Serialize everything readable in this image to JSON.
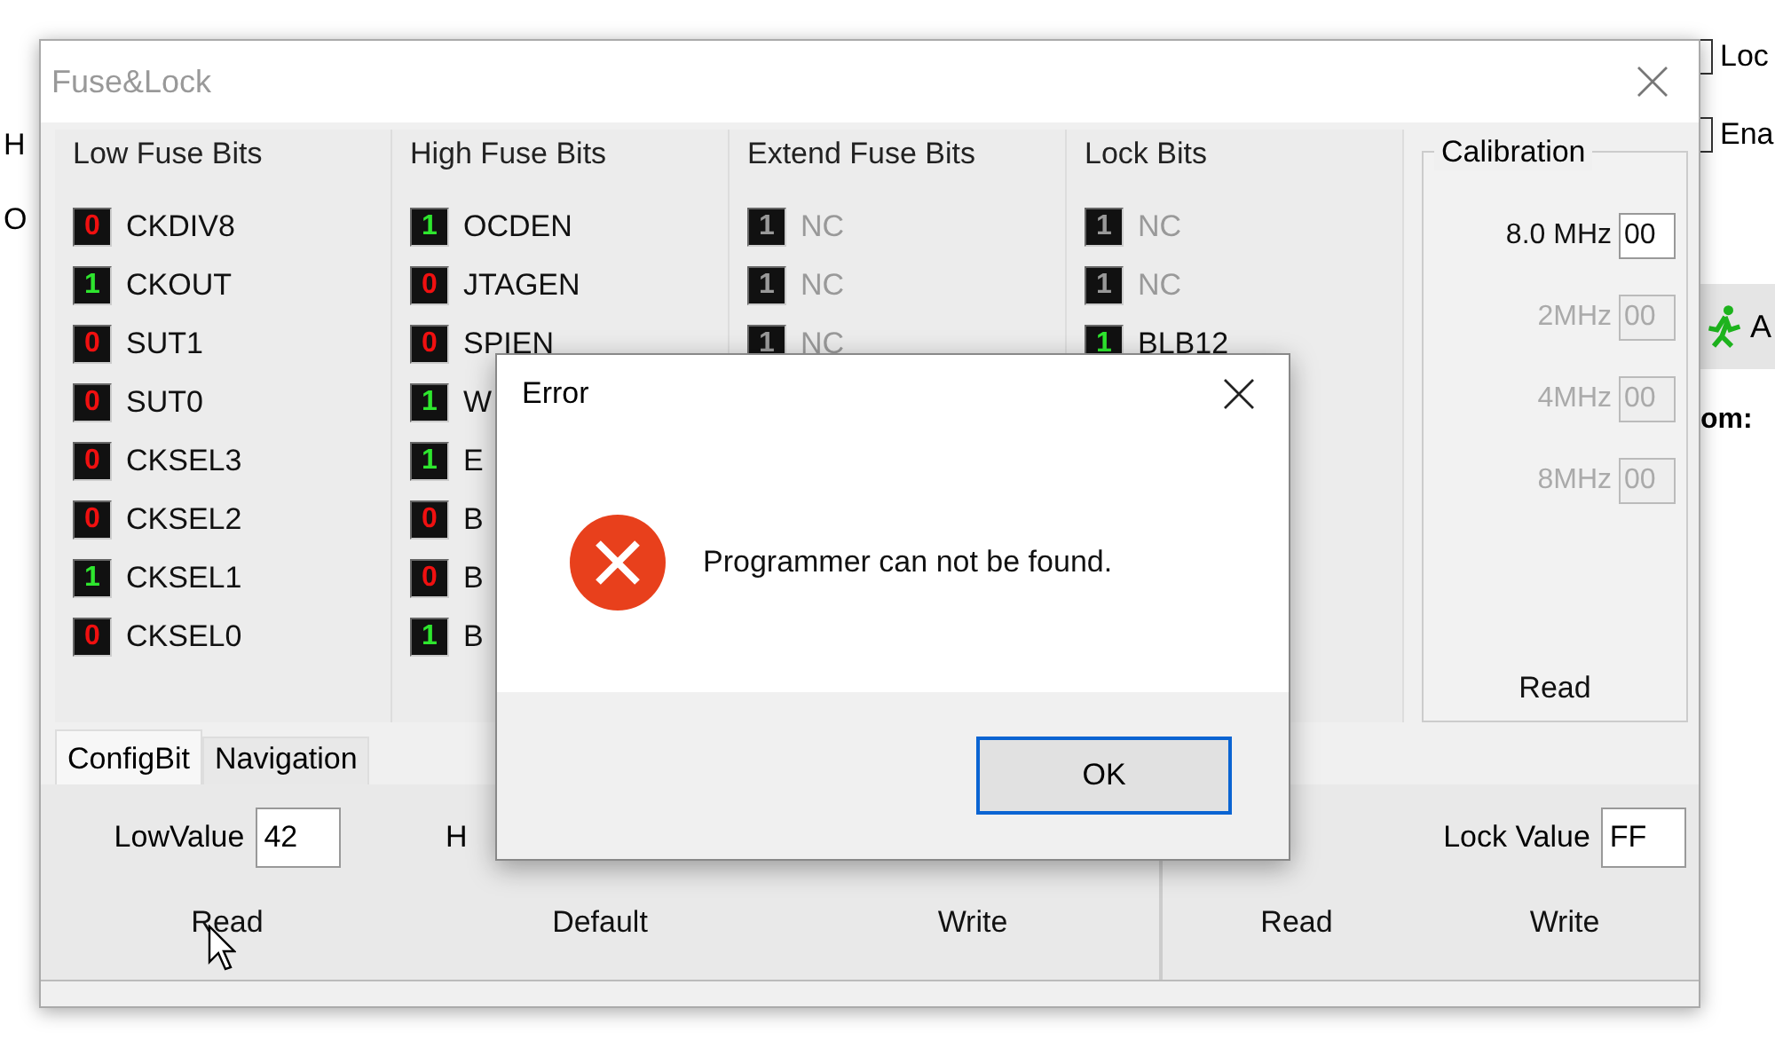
{
  "background_left": [
    "H",
    "O"
  ],
  "background_right": {
    "checkboxes": [
      {
        "label": "Loc",
        "checked": false
      },
      {
        "label": "Ena",
        "checked": false
      }
    ],
    "button": "A",
    "status": "om:"
  },
  "window": {
    "title": "Fuse&Lock"
  },
  "groups": [
    {
      "title": "Low Fuse Bits",
      "bits": [
        {
          "value": "0",
          "set": false,
          "disabled": false,
          "label": "CKDIV8"
        },
        {
          "value": "1",
          "set": true,
          "disabled": false,
          "label": "CKOUT"
        },
        {
          "value": "0",
          "set": false,
          "disabled": false,
          "label": "SUT1"
        },
        {
          "value": "0",
          "set": false,
          "disabled": false,
          "label": "SUT0"
        },
        {
          "value": "0",
          "set": false,
          "disabled": false,
          "label": "CKSEL3"
        },
        {
          "value": "0",
          "set": false,
          "disabled": false,
          "label": "CKSEL2"
        },
        {
          "value": "1",
          "set": true,
          "disabled": false,
          "label": "CKSEL1"
        },
        {
          "value": "0",
          "set": false,
          "disabled": false,
          "label": "CKSEL0"
        }
      ]
    },
    {
      "title": "High Fuse Bits",
      "bits": [
        {
          "value": "1",
          "set": true,
          "disabled": false,
          "label": "OCDEN"
        },
        {
          "value": "0",
          "set": false,
          "disabled": false,
          "label": "JTAGEN"
        },
        {
          "value": "0",
          "set": false,
          "disabled": false,
          "label": "SPIEN"
        },
        {
          "value": "1",
          "set": true,
          "disabled": false,
          "label": "W"
        },
        {
          "value": "1",
          "set": true,
          "disabled": false,
          "label": "E"
        },
        {
          "value": "0",
          "set": false,
          "disabled": false,
          "label": "B"
        },
        {
          "value": "0",
          "set": false,
          "disabled": false,
          "label": "B"
        },
        {
          "value": "1",
          "set": true,
          "disabled": false,
          "label": "B"
        }
      ]
    },
    {
      "title": "Extend Fuse Bits",
      "bits": [
        {
          "value": "1",
          "disabled": true,
          "label": "NC"
        },
        {
          "value": "1",
          "disabled": true,
          "label": "NC"
        },
        {
          "value": "1",
          "disabled": true,
          "label": "NC"
        }
      ]
    },
    {
      "title": "Lock Bits",
      "bits": [
        {
          "value": "1",
          "disabled": true,
          "label": "NC"
        },
        {
          "value": "1",
          "disabled": true,
          "label": "NC"
        },
        {
          "value": "1",
          "set": true,
          "disabled": false,
          "label": "BLB12"
        }
      ]
    }
  ],
  "calibration": {
    "title": "Calibration",
    "rows": [
      {
        "label": "8.0 MHz",
        "value": "00",
        "disabled": false
      },
      {
        "label": "2MHz",
        "value": "00",
        "disabled": true
      },
      {
        "label": "4MHz",
        "value": "00",
        "disabled": true
      },
      {
        "label": "8MHz",
        "value": "00",
        "disabled": true
      }
    ],
    "button": "Read"
  },
  "tabs": [
    {
      "label": "ConfigBit",
      "selected": true
    },
    {
      "label": "Navigation",
      "selected": false
    }
  ],
  "config": {
    "low_label": "LowValue",
    "low_value": "42",
    "high_label": "H",
    "buttons": [
      "Read",
      "Default",
      "Write"
    ],
    "lock_label": "Lock Value",
    "lock_value": "FF",
    "lock_buttons": [
      "Read",
      "Write"
    ]
  },
  "dialog": {
    "title": "Error",
    "message": "Programmer can not be found.",
    "button": "OK"
  }
}
